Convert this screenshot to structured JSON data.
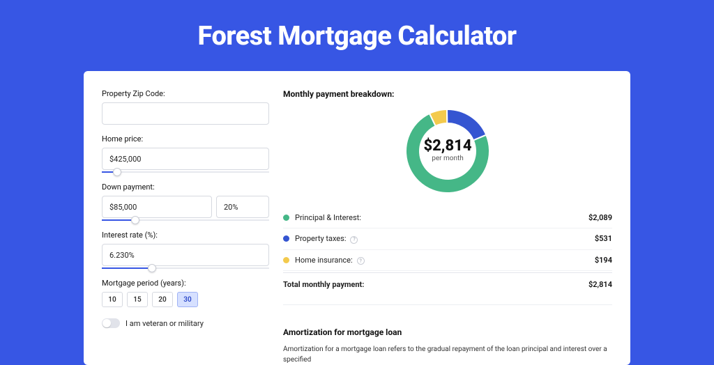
{
  "title": "Forest Mortgage Calculator",
  "form": {
    "zip": {
      "label": "Property Zip Code:",
      "value": ""
    },
    "home_price": {
      "label": "Home price:",
      "value": "$425,000",
      "slider_pct": 9
    },
    "down_payment": {
      "label": "Down payment:",
      "amount": "$85,000",
      "percent": "20%",
      "slider_pct": 20
    },
    "interest": {
      "label": "Interest rate (%):",
      "value": "6.230%",
      "slider_pct": 30
    },
    "period": {
      "label": "Mortgage period (years):",
      "options": [
        "10",
        "15",
        "20",
        "30"
      ],
      "active": "30"
    },
    "veteran": {
      "label": "I am veteran or military",
      "checked": false
    }
  },
  "breakdown": {
    "title": "Monthly payment breakdown:",
    "center_value": "$2,814",
    "center_label": "per month",
    "items": [
      {
        "label": "Principal & Interest:",
        "value": "$2,089",
        "color": "#45b787",
        "info": false,
        "share": 0.742
      },
      {
        "label": "Property taxes:",
        "value": "$531",
        "color": "#3555d1",
        "info": true,
        "share": 0.189
      },
      {
        "label": "Home insurance:",
        "value": "$194",
        "color": "#f3ca4d",
        "info": true,
        "share": 0.069
      }
    ],
    "total": {
      "label": "Total monthly payment:",
      "value": "$2,814"
    }
  },
  "amort": {
    "title": "Amortization for mortgage loan",
    "text": "Amortization for a mortgage loan refers to the gradual repayment of the loan principal and interest over a specified"
  },
  "chart_data": {
    "type": "pie",
    "title": "Monthly payment breakdown",
    "categories": [
      "Principal & Interest",
      "Property taxes",
      "Home insurance"
    ],
    "values": [
      2089,
      531,
      194
    ],
    "colors": [
      "#45b787",
      "#3555d1",
      "#f3ca4d"
    ],
    "total": 2814,
    "center_label": "$2,814 per month"
  }
}
